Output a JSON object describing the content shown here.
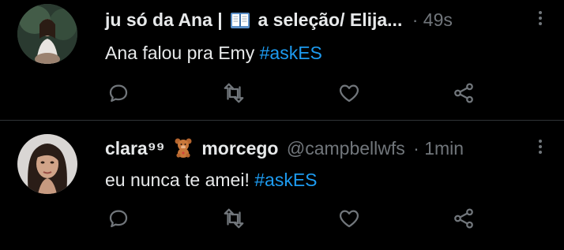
{
  "tweets": [
    {
      "display_name": "ju só da Ana |",
      "display_name_rest": "a seleção/ Elija...",
      "handle": "",
      "separator": "·",
      "time": "49s",
      "text": "Ana falou pra Emy",
      "hashtag": "#askES",
      "icons": [
        "book-emoji-icon"
      ]
    },
    {
      "display_name": "clara⁹⁹",
      "display_name_rest": "morcego",
      "handle": "@campbellwfs",
      "separator": "·",
      "time": "1min",
      "text": "eu nunca te amei!",
      "hashtag": "#askES",
      "icons": [
        "teddy-bear-emoji-icon"
      ]
    }
  ],
  "actions": [
    "reply-icon",
    "retweet-icon",
    "like-icon",
    "share-icon"
  ],
  "colors": {
    "background": "#000000",
    "text": "#e7e9ea",
    "muted": "#71767b",
    "link": "#1d9bf0",
    "divider": "#2f3336"
  }
}
